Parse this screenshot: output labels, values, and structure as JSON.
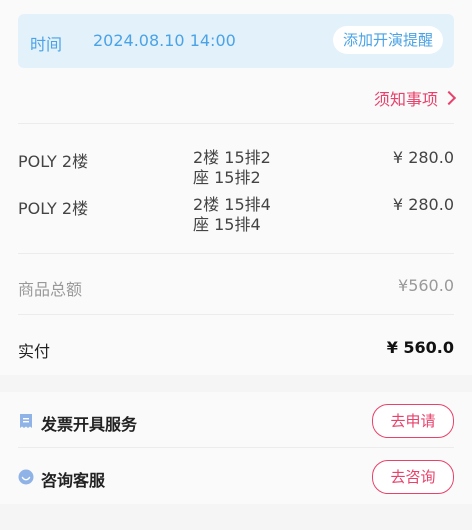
{
  "time_bar": {
    "label": "时间",
    "value": "2024.08.10 14:00",
    "remind_button": "添加开演提醒"
  },
  "notice_link": "须知事项",
  "tickets": [
    {
      "venue": "POLY 2楼",
      "seat_line1": "2楼 15排2",
      "seat_line2": "座 15排2",
      "price": "¥ 280.0"
    },
    {
      "venue": "POLY 2楼",
      "seat_line1": "2楼 15排4",
      "seat_line2": "座 15排4",
      "price": "¥ 280.0"
    }
  ],
  "subtotal": {
    "label": "商品总额",
    "value": "¥560.0"
  },
  "paid": {
    "label": "实付",
    "value": "¥ 560.0"
  },
  "services": [
    {
      "label": "发票开具服务",
      "button": "去申请",
      "icon": "invoice-icon"
    },
    {
      "label": "咨询客服",
      "button": "去咨询",
      "icon": "chat-icon"
    }
  ],
  "colors": {
    "accent": "#e8426b",
    "info": "#4aa3e6",
    "info_bg": "#e3f1fb"
  }
}
